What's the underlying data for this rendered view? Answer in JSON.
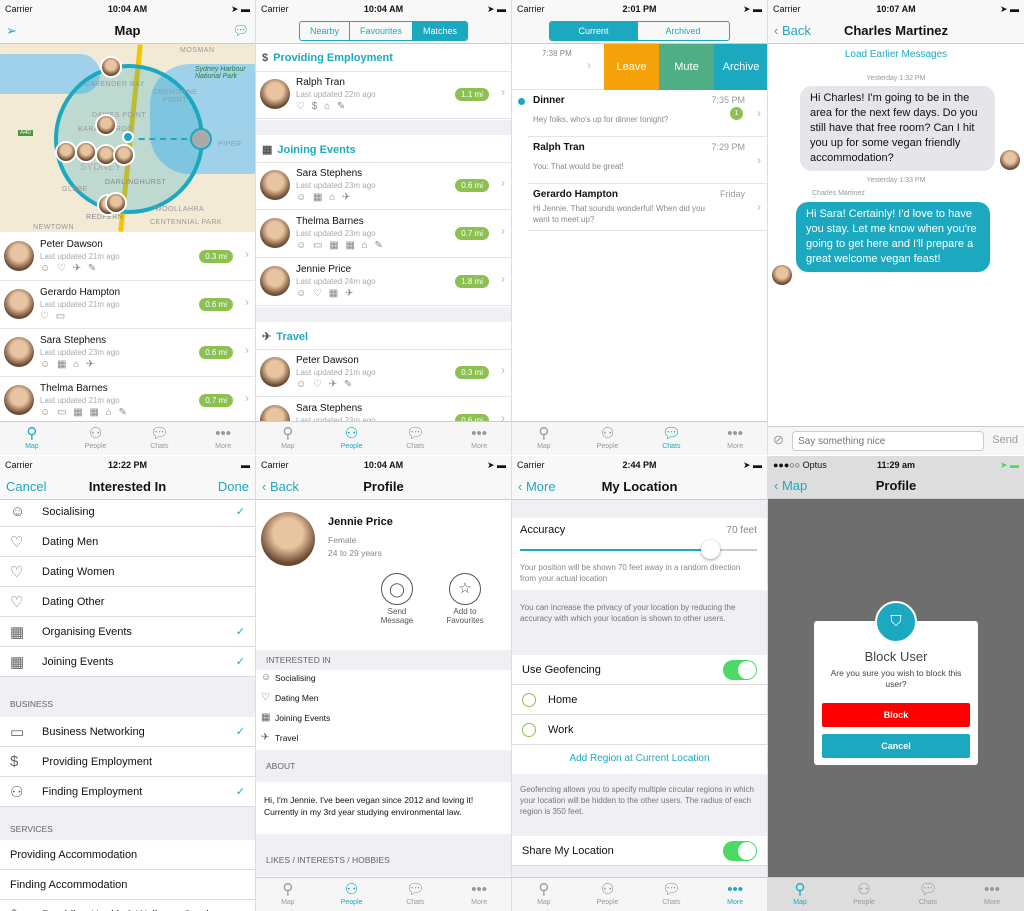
{
  "colors": {
    "accent": "#1ca9c0",
    "distance_badge": "#8cc152",
    "leave": "#f5a10a",
    "mute": "#4fae84",
    "archive": "#1ca9c0",
    "block": "#ff0000"
  },
  "tabbar": [
    "Map",
    "People",
    "Chats",
    "More"
  ],
  "map_screen": {
    "status": {
      "carrier": "Carrier",
      "time": "10:04 AM"
    },
    "title": "Map",
    "map_labels": [
      "MOSMAN",
      "Sydney Harbour National Park",
      "CAVENDER BAY",
      "CREMORNE POINT",
      "DAWES POINT",
      "BARANGAROO",
      "A40",
      "PIPER",
      "SYDNEY",
      "DARLINGHURST",
      "GLEBE",
      "WOOLLAHRA",
      "REDFERN",
      "CENTENNIAL PARK",
      "NEWTOWN"
    ],
    "people": [
      {
        "name": "Peter Dawson",
        "updated": "Last updated 21m ago",
        "distance": "0.3 mi",
        "icons": "☺ ♡ ✈ ✎"
      },
      {
        "name": "Gerardo Hampton",
        "updated": "Last updated 21m ago",
        "distance": "0.6 mi",
        "icons": "♡ ▭"
      },
      {
        "name": "Sara Stephens",
        "updated": "Last updated 23m ago",
        "distance": "0.6 mi",
        "icons": "☺ ▦ ⌂ ✈"
      },
      {
        "name": "Thelma Barnes",
        "updated": "Last updated 21m ago",
        "distance": "0.7 mi",
        "icons": "☺ ▭ ▦ ▦ ⌂ ✎"
      }
    ]
  },
  "people_screen": {
    "status": {
      "carrier": "Carrier",
      "time": "10:04 AM"
    },
    "segments": [
      "Nearby",
      "Favourites",
      "Matches"
    ],
    "sections": [
      {
        "title": "Providing Employment",
        "icon": "$",
        "people": [
          {
            "name": "Ralph Tran",
            "updated": "Last updated 22m ago",
            "distance": "1.1 mi",
            "icons": "♡ $ ⌂ ✎"
          }
        ]
      },
      {
        "title": "Joining Events",
        "icon": "▦",
        "people": [
          {
            "name": "Sara Stephens",
            "updated": "Last updated 23m ago",
            "distance": "0.6 mi",
            "icons": "☺ ▦ ⌂ ✈"
          },
          {
            "name": "Thelma Barnes",
            "updated": "Last updated 23m ago",
            "distance": "0.7 mi",
            "icons": "☺ ▭ ▦ ▦ ⌂ ✎"
          },
          {
            "name": "Jennie Price",
            "updated": "Last updated 24m ago",
            "distance": "1.8 mi",
            "icons": "☺ ♡ ▦ ✈"
          }
        ]
      },
      {
        "title": "Travel",
        "icon": "✈",
        "people": [
          {
            "name": "Peter Dawson",
            "updated": "Last updated 21m ago",
            "distance": "0.3 mi",
            "icons": "☺ ♡ ✈ ✎"
          },
          {
            "name": "Sara Stephens",
            "updated": "Last updated 23m ago",
            "distance": "0.6 mi",
            "icons": ""
          }
        ]
      }
    ]
  },
  "chats_screen": {
    "status": {
      "carrier": "Carrier",
      "time": "2:01 PM"
    },
    "segments": [
      "Current",
      "Archived"
    ],
    "swiped_time": "7:38 PM",
    "actions": [
      "Leave",
      "Mute",
      "Archive"
    ],
    "chats": [
      {
        "title": "Dinner",
        "time": "7:35 PM",
        "preview": "Hey folks, who's up for dinner tonight?",
        "unread": "1"
      },
      {
        "title": "Ralph Tran",
        "time": "7:29 PM",
        "preview": "You: That would be great!"
      },
      {
        "title": "Gerardo Hampton",
        "time": "Friday",
        "preview": "Hi Jennie. That sounds wonderful! When did you want to meet up?"
      }
    ]
  },
  "conversation": {
    "status": {
      "carrier": "Carrier",
      "time": "10:07 AM"
    },
    "back": "Back",
    "title": "Charles Martinez",
    "load_earlier": "Load Earlier Messages",
    "messages": [
      {
        "stamp": "Yesterday 1:32 PM",
        "text": "Hi Charles! I'm going to be in the area for the next few days. Do you still have that free room? Can I hit you up for some vegan friendly accommodation?"
      },
      {
        "stamp": "Yesterday 1:33 PM",
        "sender": "Charles Martinez",
        "text": "Hi Sara! Certainly! I'd love to have you stay. Let me know when you're going to get here and I'll prepare a great welcome vegan feast!"
      }
    ],
    "input_placeholder": "Say something nice",
    "send": "Send"
  },
  "interested_in": {
    "status": {
      "carrier": "Carrier",
      "time": "12:22 PM"
    },
    "cancel": "Cancel",
    "title": "Interested In",
    "done": "Done",
    "items": [
      {
        "label": "Socialising",
        "icon": "☺",
        "checked": true
      },
      {
        "label": "Dating Men",
        "icon": "♡",
        "checked": false
      },
      {
        "label": "Dating Women",
        "icon": "♡",
        "checked": false
      },
      {
        "label": "Dating Other",
        "icon": "♡",
        "checked": false
      },
      {
        "label": "Organising Events",
        "icon": "▦",
        "checked": true
      },
      {
        "label": "Joining Events",
        "icon": "▦",
        "checked": true
      }
    ],
    "business_header": "BUSINESS",
    "business": [
      {
        "label": "Business Networking",
        "icon": "▭",
        "checked": true
      },
      {
        "label": "Providing Employment",
        "icon": "$",
        "checked": false
      },
      {
        "label": "Finding Employment",
        "icon": "⚇",
        "checked": true
      }
    ],
    "services_header": "SERVICES",
    "services": [
      {
        "label": "Providing Accommodation",
        "checked": false
      },
      {
        "label": "Finding Accommodation",
        "checked": false
      },
      {
        "label": "Providing Health & Wellness Services",
        "icon": "✎",
        "checked": true
      }
    ]
  },
  "profile": {
    "status": {
      "carrier": "Carrier",
      "time": "10:04 AM"
    },
    "back": "Back",
    "title": "Profile",
    "name": "Jennie Price",
    "gender": "Female",
    "age": "24 to 29 years",
    "send_message": "Send Message",
    "add_favourites": "Add to Favourites",
    "interested_header": "INTERESTED IN",
    "interests": [
      {
        "label": "Socialising",
        "icon": "☺"
      },
      {
        "label": "Dating Men",
        "icon": "♡"
      },
      {
        "label": "Joining Events",
        "icon": "▦"
      },
      {
        "label": "Travel",
        "icon": "✈"
      }
    ],
    "about_header": "ABOUT",
    "about": "Hi, I'm Jennie. I've been vegan since 2012 and loving it! Currently in my 3rd year studying environmental law.",
    "likes_header": "LIKES / INTERESTS / HOBBIES"
  },
  "location": {
    "status": {
      "carrier": "Carrier",
      "time": "2:44 PM"
    },
    "back": "More",
    "title": "My Location",
    "accuracy_label": "Accuracy",
    "accuracy_value": "70 feet",
    "accuracy_fraction": 0.8,
    "accuracy_note": "Your position will be shown 70 feet away in a random direction from your actual location",
    "privacy_note": "You can increase the privacy of your location by reducing the accuracy with which your location is shown to other users.",
    "geofencing": "Use Geofencing",
    "geofencing_on": true,
    "regions": [
      "Home",
      "Work"
    ],
    "add_region": "Add Region at Current Location",
    "geofencing_note": "Geofencing allows you to specify multiple circular regions in which your location will be hidden to the other users. The radius of each region is 350 feet.",
    "share": "Share My Location",
    "share_on": true
  },
  "block": {
    "status": {
      "carrier": "●●●○○ Optus",
      "time": "11:29 am"
    },
    "back": "Map",
    "title": "Profile",
    "dialog_title": "Block User",
    "dialog_text": "Are you sure you wish to block this user?",
    "block": "Block",
    "cancel": "Cancel"
  }
}
